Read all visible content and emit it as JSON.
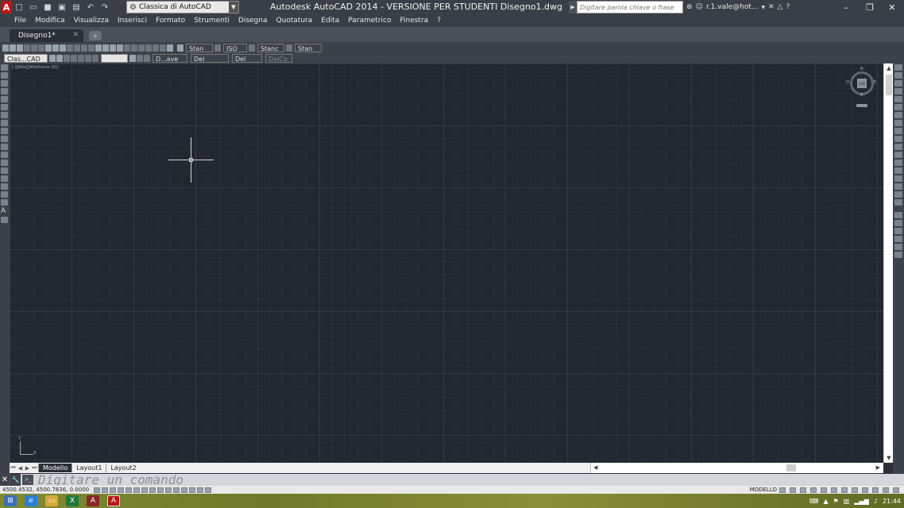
{
  "app": {
    "window_title": "Autodesk AutoCAD 2014 - VERSIONE PER STUDENTI    Disegno1.dwg",
    "workspace": "Classica di AutoCAD",
    "search_placeholder": "Digitare parola chiave o frase",
    "user": "r.1.vale@hot...",
    "logo_letter": "A"
  },
  "menu": [
    "File",
    "Modifica",
    "Visualizza",
    "Inserisci",
    "Formato",
    "Strumenti",
    "Disegna",
    "Quotatura",
    "Edita",
    "Parametrico",
    "Finestra",
    "?"
  ],
  "doc_tab": {
    "label": "Disegno1*"
  },
  "toolbars": {
    "text_style": "Stan",
    "dim_style": "ISO",
    "table_style": "Stanc",
    "multileader_style": "Stan",
    "workspace_combo": "Clas...CAD",
    "layer_combo": "",
    "color_combo": "D...ave",
    "linetype_combo": "Del",
    "lineweight_combo": "Del",
    "plotstyle_combo": "DalCo"
  },
  "viewport": {
    "label": "[-][Alto][Wireframe 2D]",
    "viewcube_face": "SUP",
    "viewcube_dirs": {
      "n": "N",
      "s": "S",
      "e": "E",
      "w": "O"
    },
    "ucs_x": "X",
    "ucs_y": "Y"
  },
  "layout_tabs": [
    "Modello",
    "Layout1",
    "Layout2"
  ],
  "command": {
    "prompt": "Digitare un comando"
  },
  "status": {
    "coords": "4500.4532, 4500.7836, 0.0000",
    "space": "MODELLO"
  },
  "taskbar": {
    "time": "21:44"
  },
  "colors": {
    "canvas": "#212830",
    "ui_dark": "#3a3f47",
    "accent": "#b51a1a"
  }
}
